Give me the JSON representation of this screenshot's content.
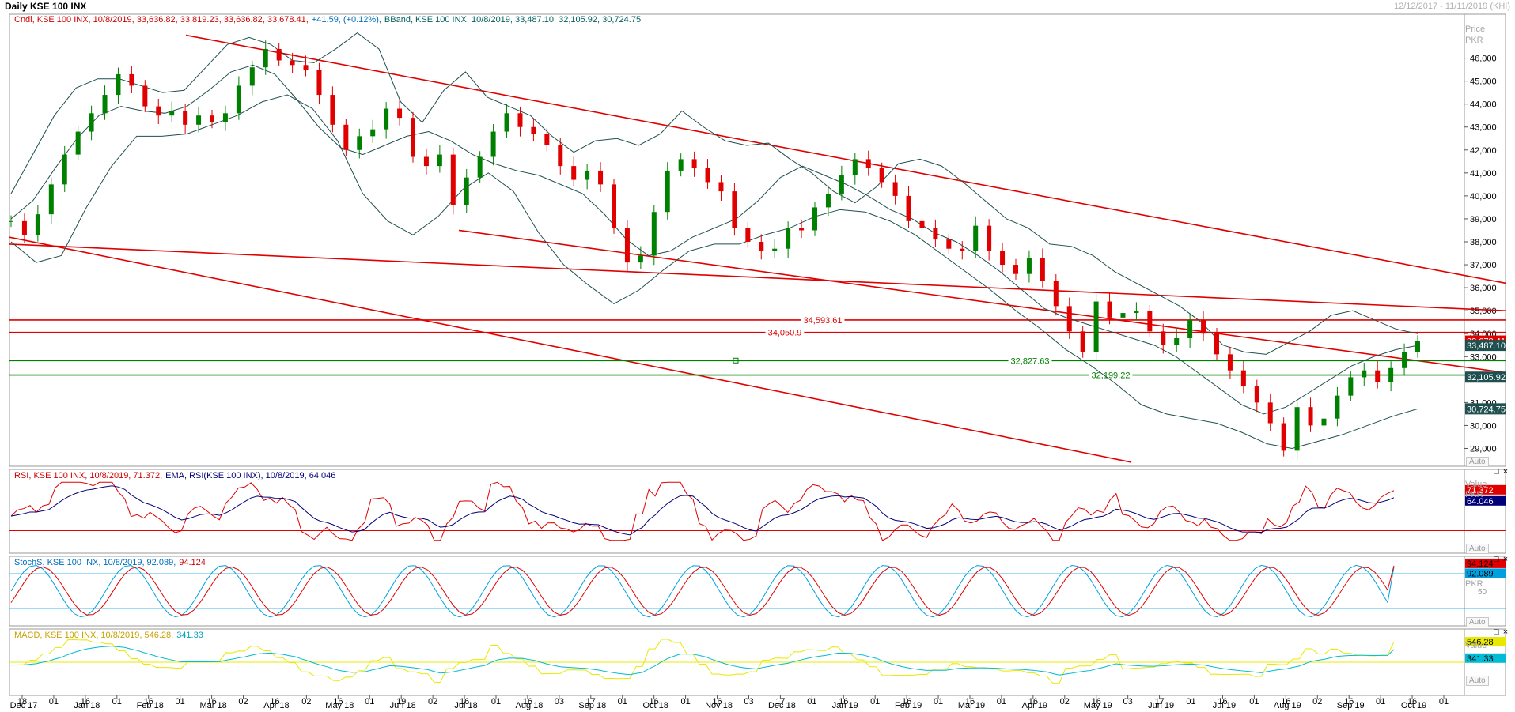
{
  "window": {
    "title": "Daily KSE 100 INX",
    "date_range": "12/12/2017 - 11/11/2019 (KHI)"
  },
  "price_panel": {
    "legend_cndl": "Cndl, KSE 100 INX, 10/8/2019, 33,636.82, 33,819.23, 33,636.82, 33,678.41,",
    "legend_change": "+41.59, (+0.12%),",
    "legend_bband": "BBand, KSE 100 INX, 10/8/2019, 33,487.10, 32,105.92, 30,724.75",
    "axis_title": "Price\nPKR",
    "price_tag_last": "33,678.41",
    "bb_mid_tag": "33,487.10",
    "bb_lower_tag": "32,105.92",
    "bb_low2_tag": "30,724.75",
    "auto": "Auto",
    "level_labels": [
      "34,593.61",
      "34,050.9",
      "32,827.63",
      "32,199.22"
    ]
  },
  "rsi_panel": {
    "legend_rsi": "RSI, KSE 100 INX, 10/8/2019, 71.372,",
    "legend_ema": "EMA, RSI(KSE 100 INX), 10/8/2019, 64.046",
    "axis_title": "Value\nPKR",
    "tag_rsi": "71.372",
    "tag_ema": "64.046",
    "auto": "Auto"
  },
  "stoch_panel": {
    "legend_a": "StochS, KSE 100 INX, 10/8/2019, 92.089,",
    "legend_b": "94.124",
    "axis_title": "PKR",
    "tag_a": "94.124",
    "tag_b": "92.089",
    "tick_50": "50",
    "auto": "Auto"
  },
  "macd_panel": {
    "legend_a": "MACD, KSE 100 INX, 10/8/2019, 546.28,",
    "legend_b": "341.33",
    "axis_title": "Value",
    "tag_a": "546.28",
    "tag_b": "341.33",
    "auto": "Auto"
  },
  "panel_buttons": "□ ×",
  "colors": {
    "red": "#e00000",
    "green": "#008000",
    "navy": "#00007a",
    "bband": "#1f4f4f",
    "cyan": "#00a0e0",
    "yellow": "#e8e800",
    "teal": "#00bcd4",
    "text_red": "#d00000",
    "text_navy": "#00007a",
    "text_teal": "#006060",
    "text_blue": "#0070c0",
    "text_gold": "#c8a000"
  },
  "chart_data": {
    "type": "line",
    "title": "Daily KSE 100 INX",
    "y_axis_ticks": [
      "46,000",
      "45,000",
      "44,000",
      "43,000",
      "42,000",
      "41,000",
      "40,000",
      "39,000",
      "38,000",
      "37,000",
      "36,000",
      "35,000",
      "34,000",
      "33,000",
      "31,000",
      "30,000",
      "29,000"
    ],
    "y_range": [
      28500,
      47500
    ],
    "x_tick_labels": [
      {
        "day": "18",
        "month": "Dec 17"
      },
      {
        "day": "01",
        "month": ""
      },
      {
        "day": "16",
        "month": "Jan 18"
      },
      {
        "day": "01",
        "month": ""
      },
      {
        "day": "16",
        "month": "Feb 18"
      },
      {
        "day": "01",
        "month": ""
      },
      {
        "day": "16",
        "month": "Mar 18"
      },
      {
        "day": "02",
        "month": ""
      },
      {
        "day": "16",
        "month": "Apr 18"
      },
      {
        "day": "02",
        "month": ""
      },
      {
        "day": "16",
        "month": "May 18"
      },
      {
        "day": "01",
        "month": ""
      },
      {
        "day": "19",
        "month": "Jun 18"
      },
      {
        "day": "02",
        "month": ""
      },
      {
        "day": "16",
        "month": "Jul 18"
      },
      {
        "day": "01",
        "month": ""
      },
      {
        "day": "16",
        "month": "Aug 18"
      },
      {
        "day": "03",
        "month": ""
      },
      {
        "day": "17",
        "month": "Sep 18"
      },
      {
        "day": "01",
        "month": ""
      },
      {
        "day": "16",
        "month": "Oct 18"
      },
      {
        "day": "01",
        "month": ""
      },
      {
        "day": "16",
        "month": "Nov 18"
      },
      {
        "day": "03",
        "month": ""
      },
      {
        "day": "17",
        "month": "Dec 18"
      },
      {
        "day": "01",
        "month": ""
      },
      {
        "day": "16",
        "month": "Jan 19"
      },
      {
        "day": "01",
        "month": ""
      },
      {
        "day": "16",
        "month": "Feb 19"
      },
      {
        "day": "01",
        "month": ""
      },
      {
        "day": "16",
        "month": "Mar 19"
      },
      {
        "day": "01",
        "month": ""
      },
      {
        "day": "16",
        "month": "Apr 19"
      },
      {
        "day": "02",
        "month": ""
      },
      {
        "day": "16",
        "month": "May 19"
      },
      {
        "day": "03",
        "month": ""
      },
      {
        "day": "17",
        "month": "Jun 19"
      },
      {
        "day": "01",
        "month": ""
      },
      {
        "day": "16",
        "month": "Jul 19"
      },
      {
        "day": "01",
        "month": ""
      },
      {
        "day": "16",
        "month": "Aug 19"
      },
      {
        "day": "02",
        "month": ""
      },
      {
        "day": "16",
        "month": "Sep 19"
      },
      {
        "day": "01",
        "month": ""
      },
      {
        "day": "16",
        "month": "Oct 19"
      },
      {
        "day": "01",
        "month": ""
      }
    ],
    "series": [
      {
        "name": "KSE 100 INX",
        "values": [
          38900,
          38300,
          39200,
          40500,
          41800,
          42800,
          43600,
          44400,
          45300,
          44800,
          43900,
          43500,
          43700,
          43100,
          43500,
          43200,
          43600,
          44800,
          45600,
          46400,
          45900,
          45700,
          45500,
          44400,
          43100,
          42000,
          42600,
          42900,
          43800,
          43400,
          41700,
          41300,
          41800,
          39600,
          40800,
          41700,
          42800,
          43600,
          43000,
          42700,
          42200,
          41300,
          40700,
          41100,
          40500,
          38600,
          37100,
          37400,
          39300,
          41100,
          41600,
          41200,
          40600,
          40200,
          38600,
          38000,
          37600,
          37700,
          38600,
          38500,
          39500,
          40100,
          40900,
          41600,
          41200,
          40600,
          40000,
          38900,
          38600,
          38100,
          37700,
          37600,
          38700,
          37600,
          37000,
          36600,
          37300,
          36300,
          35200,
          34100,
          33200,
          35400,
          34700,
          34900,
          35000,
          34100,
          33500,
          33800,
          34600,
          34000,
          33100,
          32400,
          31700,
          31000,
          30100,
          28900,
          30800,
          30000,
          30300,
          31300,
          32100,
          32400,
          31900,
          32500,
          33200,
          33678.41
        ]
      },
      {
        "name": "BBand upper",
        "values": [
          40100,
          41800,
          43500,
          44700,
          45100,
          45100,
          44800,
          44500,
          44600,
          45600,
          46600,
          46900,
          46600,
          45900,
          45800,
          46400,
          47100,
          46400,
          44100,
          43200,
          44600,
          45400,
          44300,
          43900,
          43500,
          42600,
          41900,
          42400,
          42500,
          42200,
          42700,
          43700,
          43000,
          42400,
          42200,
          42300,
          41600,
          41000,
          40200,
          39700,
          40400,
          41400,
          41600,
          41300,
          40600,
          39800,
          39000,
          38600,
          37900,
          37800,
          37400,
          36700,
          36200,
          35700,
          35200,
          34500,
          33500,
          33200,
          33100,
          33600,
          34100,
          34800,
          35000,
          34600,
          34200,
          34000
        ]
      },
      {
        "name": "BBand middle",
        "values": [
          39000,
          39800,
          41200,
          42500,
          43500,
          43900,
          43700,
          43600,
          43900,
          44600,
          45400,
          45700,
          45300,
          44200,
          43000,
          42100,
          41800,
          42200,
          42600,
          42800,
          42400,
          41800,
          41400,
          41100,
          40900,
          40500,
          40100,
          39200,
          38100,
          37400,
          37600,
          38200,
          38600,
          39000,
          39800,
          40800,
          41300,
          40900,
          40500,
          40000,
          39400,
          39000,
          38400,
          38000,
          37400,
          36700,
          35900,
          35100,
          34700,
          34400,
          34100,
          33800,
          33500,
          33000,
          32300,
          31600,
          30900,
          30500,
          30800,
          31400,
          32000,
          32600,
          33000,
          33300,
          33487.1
        ]
      },
      {
        "name": "BBand lower",
        "values": [
          38000,
          37100,
          37400,
          39500,
          41300,
          42600,
          42600,
          42700,
          43100,
          43500,
          44100,
          44400,
          43800,
          42400,
          40100,
          38900,
          38300,
          39100,
          40300,
          41000,
          40200,
          38400,
          37000,
          36100,
          35300,
          35900,
          36800,
          37600,
          37900,
          37900,
          38300,
          38600,
          39100,
          39400,
          39300,
          38900,
          38300,
          37500,
          36700,
          35900,
          35000,
          34200,
          33300,
          32600,
          31800,
          30900,
          30500,
          30300,
          30100,
          29700,
          29200,
          29000,
          29300,
          29600,
          30000,
          30400,
          30724.75
        ]
      }
    ],
    "horizontal_levels": [
      {
        "label": "34,593.61",
        "value": 34593.61,
        "color": "red"
      },
      {
        "label": "34,050.9",
        "value": 34050.9,
        "color": "red"
      },
      {
        "label": "32,827.63",
        "value": 32827.63,
        "color": "green"
      },
      {
        "label": "32,199.22",
        "value": 32199.22,
        "color": "green"
      }
    ],
    "trend_lines": [
      {
        "name": "upper channel",
        "from": [
          "Jan 18 start",
          47000
        ],
        "to": [
          "Oct 19 end",
          36200
        ]
      },
      {
        "name": "middle channel",
        "from": [
          "Jul 18",
          38500
        ],
        "to": [
          "Oct 19 end",
          32300
        ]
      },
      {
        "name": "long support",
        "from": [
          "Dec 17",
          37900
        ],
        "to": [
          "Oct 19 end",
          35000
        ]
      },
      {
        "name": "lower channel",
        "from": [
          "Dec 17",
          38200
        ],
        "to": [
          "Aug 19",
          28400
        ]
      }
    ],
    "indicators": {
      "rsi_last": 71.372,
      "rsi_ema_last": 64.046,
      "stoch_k_last": 92.089,
      "stoch_d_last": 94.124,
      "macd_last": 546.28,
      "macd_signal_last": 341.33
    },
    "grid": false,
    "legend_position": "top-left"
  }
}
